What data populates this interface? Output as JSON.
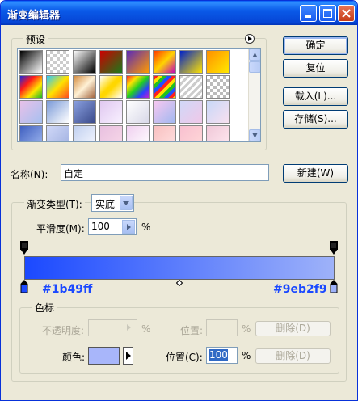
{
  "window": {
    "title": "渐变编辑器",
    "controls": [
      "minimize-icon",
      "maximize-icon",
      "close-icon"
    ]
  },
  "presets": {
    "group_label": "预设",
    "menu_icon": "circle-arrow-right-icon",
    "scroll_up_icon": "arrow-up-icon",
    "scroll_down_icon": "arrow-down-icon",
    "swatches": [
      {
        "css": "linear-gradient(135deg,#000,#fff)"
      },
      {
        "css": "repeating-conic-gradient(#ccc 0% 25%, #fff 0% 50%) 0 0/8px 8px"
      },
      {
        "css": "linear-gradient(135deg,#fff,#000)"
      },
      {
        "css": "linear-gradient(135deg,#c00,#1a7a1a)"
      },
      {
        "css": "linear-gradient(135deg,#5a2ab8,#ff9a00)"
      },
      {
        "css": "linear-gradient(135deg,#ff3800,#ffd400,#c000c0)"
      },
      {
        "css": "linear-gradient(135deg,#0022c8,#ffe400)"
      },
      {
        "css": "linear-gradient(135deg,#ff9000,#ffe800)"
      },
      {
        "css": "linear-gradient(135deg,#1a2adc,#ff1a1a,#ffe600,#19b92a)"
      },
      {
        "css": "linear-gradient(135deg,#2cc9ff,#ffe200,#ff4b20)"
      },
      {
        "css": "linear-gradient(135deg,#d48a3c,#fff1d6,#a0603a)"
      },
      {
        "css": "linear-gradient(135deg,#fff 0%,#ffd700 45%,#ffd700 55%,#fff 100%)"
      },
      {
        "css": "linear-gradient(135deg,#ff2828,#ffe200,#20d020,#2a40ff,#c020d0)"
      },
      {
        "css": "repeating-linear-gradient(135deg,#ff2020 0 4px,#ffe000 4px 8px,#20c020 8px 12px,#2050ff 12px 16px)"
      },
      {
        "css": "repeating-linear-gradient(135deg,#ccc 0 3px,#fff 3px 6px)"
      },
      {
        "css": "repeating-conic-gradient(#bbb 0% 25%, #fff 0% 50%) 0 0/8px 8px"
      },
      {
        "css": "linear-gradient(135deg,#e8c0e8,#a6c0f0)"
      },
      {
        "css": "linear-gradient(135deg,#7a9ad8,#ffffff)"
      },
      {
        "css": "linear-gradient(135deg,#8aa0e0,#3a4a8a)"
      },
      {
        "css": "linear-gradient(135deg,#e0c8f0,#f8f0ff)"
      },
      {
        "css": "linear-gradient(135deg,#ffffff,#d8d8e8)"
      },
      {
        "css": "linear-gradient(135deg,#f8c8f0,#a0b8f0)"
      },
      {
        "css": "linear-gradient(135deg,#d0d8f8,#f0c8e8)"
      },
      {
        "css": "linear-gradient(135deg,#c8d8f8,#f8e0f0)"
      },
      {
        "css": "linear-gradient(135deg,#4060c0,#a0b8f0)"
      },
      {
        "css": "linear-gradient(135deg,#d0d8f8,#a0b0e0)"
      },
      {
        "css": "linear-gradient(135deg,#c0d0f0,#f8f8ff)"
      },
      {
        "css": "linear-gradient(135deg,#e8c0e0,#f8d8e8)"
      },
      {
        "css": "linear-gradient(135deg,#f0d0f0,#ffffff)"
      },
      {
        "css": "linear-gradient(135deg,#f8c0c0,#ffe0e0)"
      },
      {
        "css": "linear-gradient(135deg,#f8c0d0,#ffd8d8)"
      },
      {
        "css": "linear-gradient(135deg,#f0c8d8,#ffe8f0)"
      }
    ]
  },
  "buttons": {
    "ok": "确定",
    "reset": "复位",
    "load": "载入(L)...",
    "save": "存储(S)...",
    "new": "新建(W)"
  },
  "name": {
    "label": "名称(N):",
    "value": "自定"
  },
  "gradient_type": {
    "label": "渐变类型(T):",
    "value": "实底"
  },
  "smoothness": {
    "label": "平滑度(M):",
    "value": "100",
    "unit": "%"
  },
  "gradient": {
    "start_color": "#1b49ff",
    "end_color": "#9eb2f9",
    "start_label": "#1b49ff",
    "end_label": "#9eb2f9",
    "midpoint_icon": "diamond-icon",
    "opacity_stop_icon": "opacity-stop-icon",
    "color_stop_icon": "color-stop-icon"
  },
  "stops": {
    "group_label": "色标",
    "opacity_label": "不透明度:",
    "opacity_unit": "%",
    "opacity_position_label": "位置:",
    "opacity_position_unit": "%",
    "delete_label_1": "删除(D)",
    "color_label": "颜色:",
    "color_value": "#a8b6fa",
    "color_position_label": "位置(C):",
    "color_position_value": "100",
    "color_position_unit": "%",
    "delete_label_2": "删除(D)"
  }
}
